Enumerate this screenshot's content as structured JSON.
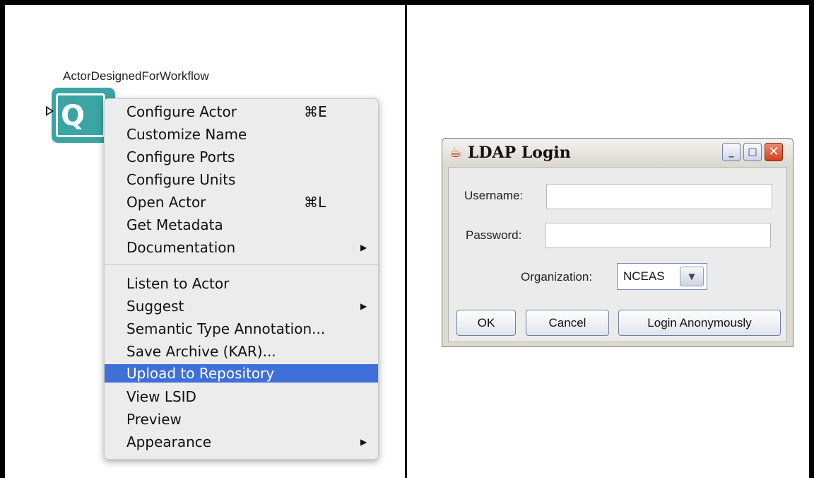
{
  "actor": {
    "name": "ActorDesignedForWorkflow",
    "icon": "database-actor-icon",
    "color": "#3aa5a3"
  },
  "context_menu": {
    "items": [
      {
        "label": "Configure Actor",
        "shortcut": "⌘E",
        "submenu": false,
        "selected": false
      },
      {
        "label": "Customize Name",
        "shortcut": "",
        "submenu": false,
        "selected": false
      },
      {
        "label": "Configure Ports",
        "shortcut": "",
        "submenu": false,
        "selected": false
      },
      {
        "label": "Configure Units",
        "shortcut": "",
        "submenu": false,
        "selected": false
      },
      {
        "label": "Open Actor",
        "shortcut": "⌘L",
        "submenu": false,
        "selected": false
      },
      {
        "label": "Get Metadata",
        "shortcut": "",
        "submenu": false,
        "selected": false
      },
      {
        "label": "Documentation",
        "shortcut": "",
        "submenu": true,
        "selected": false
      },
      {
        "label": "Listen to Actor",
        "shortcut": "",
        "submenu": false,
        "selected": false
      },
      {
        "label": "Suggest",
        "shortcut": "",
        "submenu": true,
        "selected": false
      },
      {
        "label": "Semantic Type Annotation...",
        "shortcut": "",
        "submenu": false,
        "selected": false
      },
      {
        "label": "Save Archive (KAR)...",
        "shortcut": "",
        "submenu": false,
        "selected": false
      },
      {
        "label": "Upload to Repository",
        "shortcut": "",
        "submenu": false,
        "selected": true
      },
      {
        "label": "View LSID",
        "shortcut": "",
        "submenu": false,
        "selected": false
      },
      {
        "label": "Preview",
        "shortcut": "",
        "submenu": false,
        "selected": false
      },
      {
        "label": "Appearance",
        "shortcut": "",
        "submenu": true,
        "selected": false
      }
    ],
    "highlight_color": "#3f6fd8"
  },
  "dialog": {
    "title": "LDAP Login",
    "title_icon": "java-cup-icon",
    "window_buttons": {
      "minimize": "_",
      "maximize": "□",
      "close": "✕"
    },
    "username": {
      "label": "Username:",
      "value": ""
    },
    "password": {
      "label": "Password:",
      "value": ""
    },
    "organization": {
      "label": "Organization:",
      "value": "NCEAS"
    },
    "buttons": {
      "ok": "OK",
      "cancel": "Cancel",
      "anonymous": "Login Anonymously"
    }
  }
}
